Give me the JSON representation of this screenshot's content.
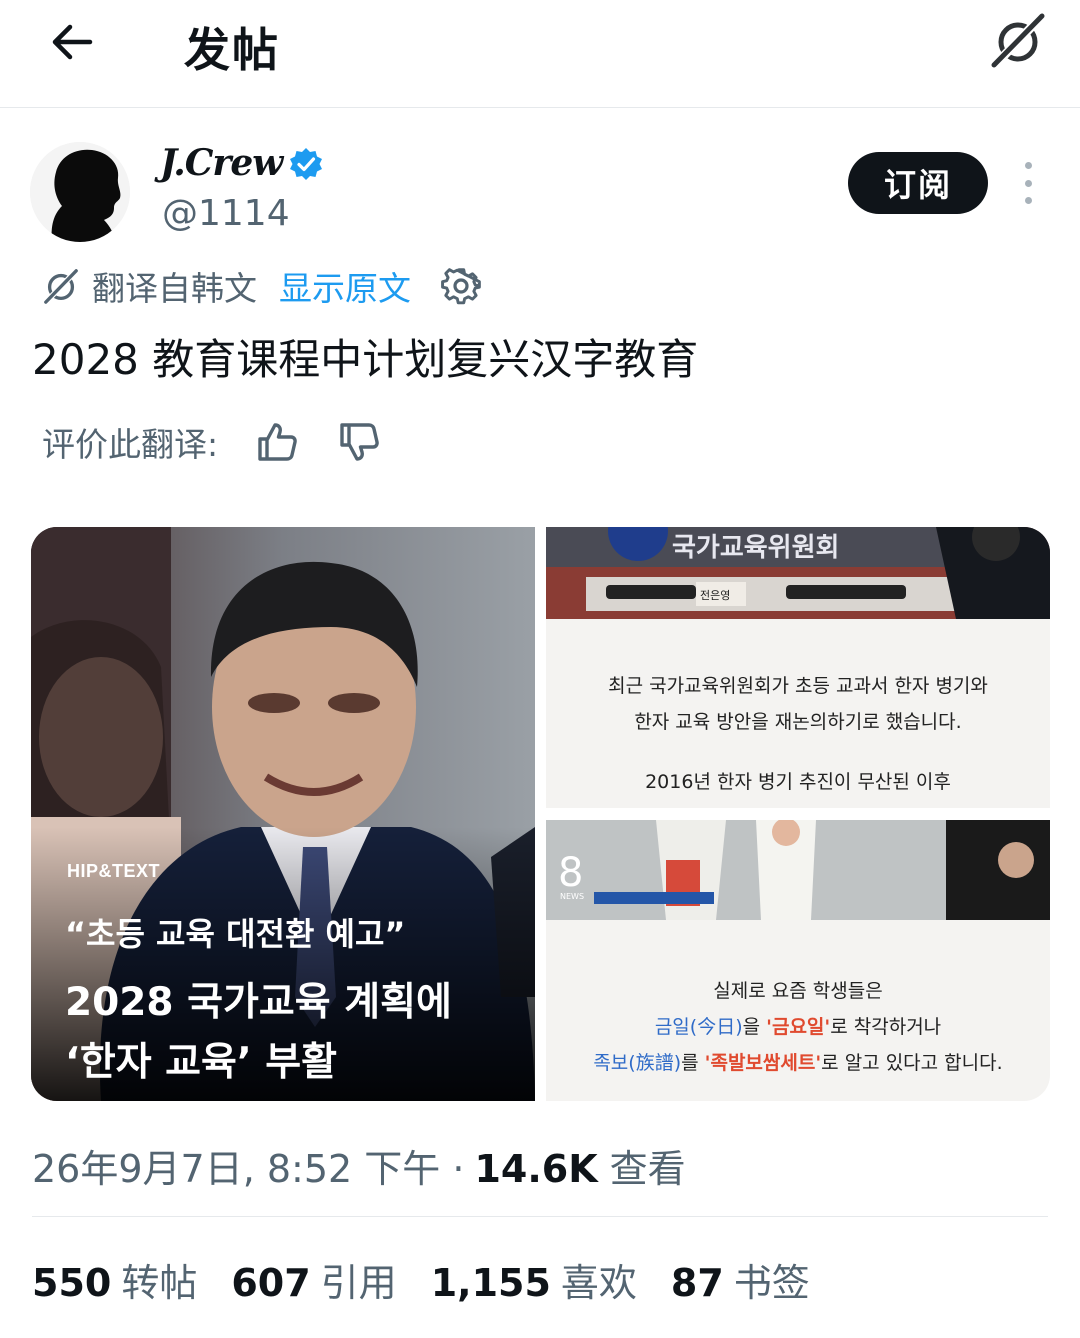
{
  "header": {
    "title": "发帖",
    "back_icon": "back-arrow-icon",
    "grok_icon": "grok-icon"
  },
  "author": {
    "name": "J.Crew",
    "handle": "@1114",
    "verified": true,
    "subscribe_label": "订阅",
    "colors": {
      "verified": "#1d9bf0",
      "subscribe_bg": "#0f1419"
    }
  },
  "translation": {
    "source_label": "翻译自韩文",
    "show_original_label": "显示原文",
    "rate_label": "评价此翻译:"
  },
  "post": {
    "text": "2028 教育课程中计划复兴汉字教育",
    "timestamp": "26年9月7日, 8:52 下午 ·",
    "views": "14.6K",
    "views_label": "查看"
  },
  "media": {
    "main": {
      "brand": "HIP&TEXT",
      "quote": "“초등 교육 대전환 예고”",
      "headline_line1": "2028 국가교육 계획에",
      "headline_line2": "‘한자 교육’ 부활"
    },
    "top_right": {
      "banner": "국가교육위원회",
      "nameplate": "전은영",
      "line1": "최근 국가교육위원회가 초등 교과서 한자 병기와",
      "line2": "한자 교육 방안을 재논의하기로 했습니다.",
      "line3": "2016년 한자 병기 추진이 무산된 이후"
    },
    "bottom_right": {
      "channel_logo": "8",
      "channel_sub": "NEWS",
      "line1": "실제로 요즘 학생들은",
      "line2_a": "금일(今日)",
      "line2_b": "을 ",
      "line2_c": "'금요일'",
      "line2_d": "로 착각하거나",
      "line3_a": "족보(族譜)",
      "line3_b": "를 ",
      "line3_c": "'족발보쌈세트'",
      "line3_d": "로 알고 있다고 합니다."
    }
  },
  "stats": [
    {
      "count": "550",
      "label": "转帖"
    },
    {
      "count": "607",
      "label": "引用"
    },
    {
      "count": "1,155",
      "label": "喜欢"
    },
    {
      "count": "87",
      "label": "书签"
    }
  ]
}
